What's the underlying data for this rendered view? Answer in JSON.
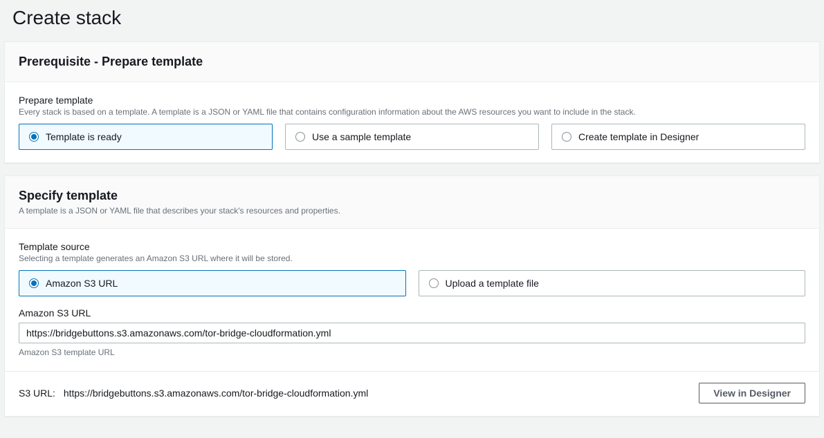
{
  "page": {
    "title": "Create stack"
  },
  "prerequisite": {
    "heading": "Prerequisite - Prepare template",
    "prepare_label": "Prepare template",
    "prepare_hint": "Every stack is based on a template. A template is a JSON or YAML file that contains configuration information about the AWS resources you want to include in the stack.",
    "options": {
      "ready": "Template is ready",
      "sample": "Use a sample template",
      "designer": "Create template in Designer"
    }
  },
  "specify": {
    "heading": "Specify template",
    "subtext": "A template is a JSON or YAML file that describes your stack's resources and properties.",
    "source_label": "Template source",
    "source_hint": "Selecting a template generates an Amazon S3 URL where it will be stored.",
    "options": {
      "s3": "Amazon S3 URL",
      "upload": "Upload a template file"
    },
    "url_label": "Amazon S3 URL",
    "url_value": "https://bridgebuttons.s3.amazonaws.com/tor-bridge-cloudformation.yml",
    "url_hint": "Amazon S3 template URL",
    "s3_display_label": "S3 URL:",
    "s3_display_value": "https://bridgebuttons.s3.amazonaws.com/tor-bridge-cloudformation.yml",
    "view_designer_btn": "View in Designer"
  }
}
